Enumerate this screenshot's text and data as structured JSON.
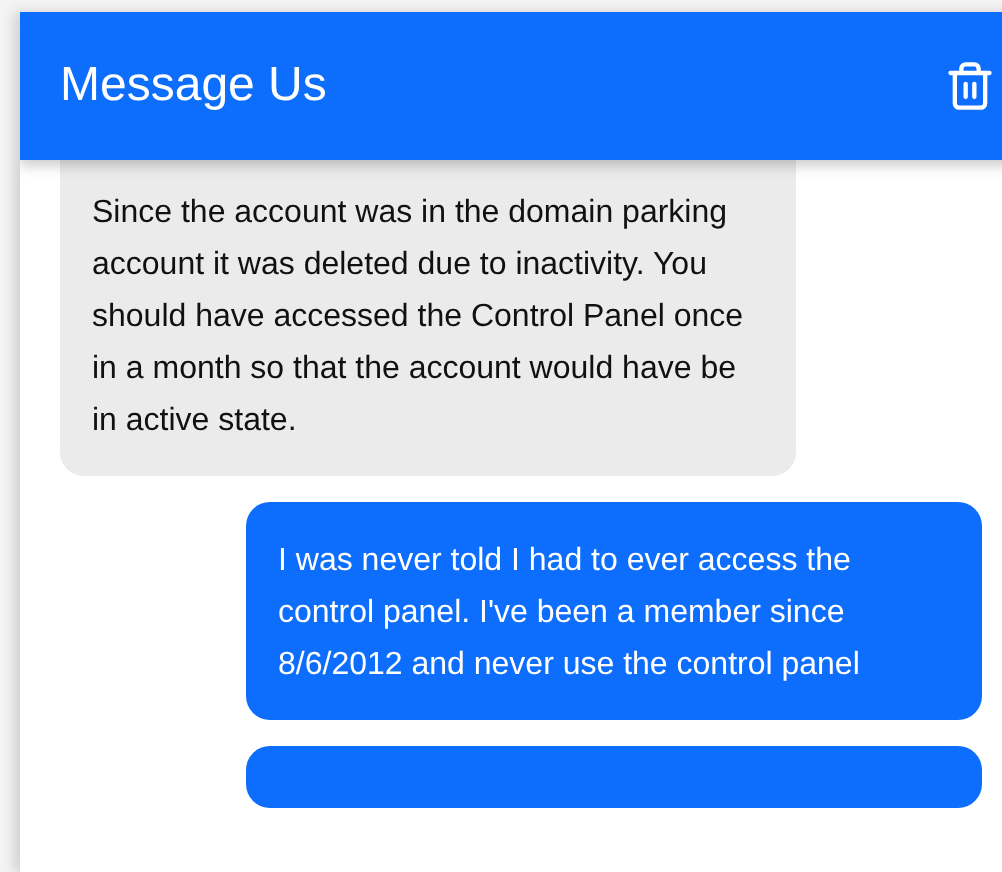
{
  "header": {
    "title": "Message Us"
  },
  "messages": [
    {
      "kind": "received",
      "text": "Since the account was in the domain parking account it was deleted due to inactivity. You should have accessed the Control Panel once in a month so that the account would have be in active state."
    },
    {
      "kind": "sent",
      "text": "I was never told I had to ever access the control panel. I've been a member since 8/6/2012 and never use the control panel"
    },
    {
      "kind": "sent"
    }
  ]
}
